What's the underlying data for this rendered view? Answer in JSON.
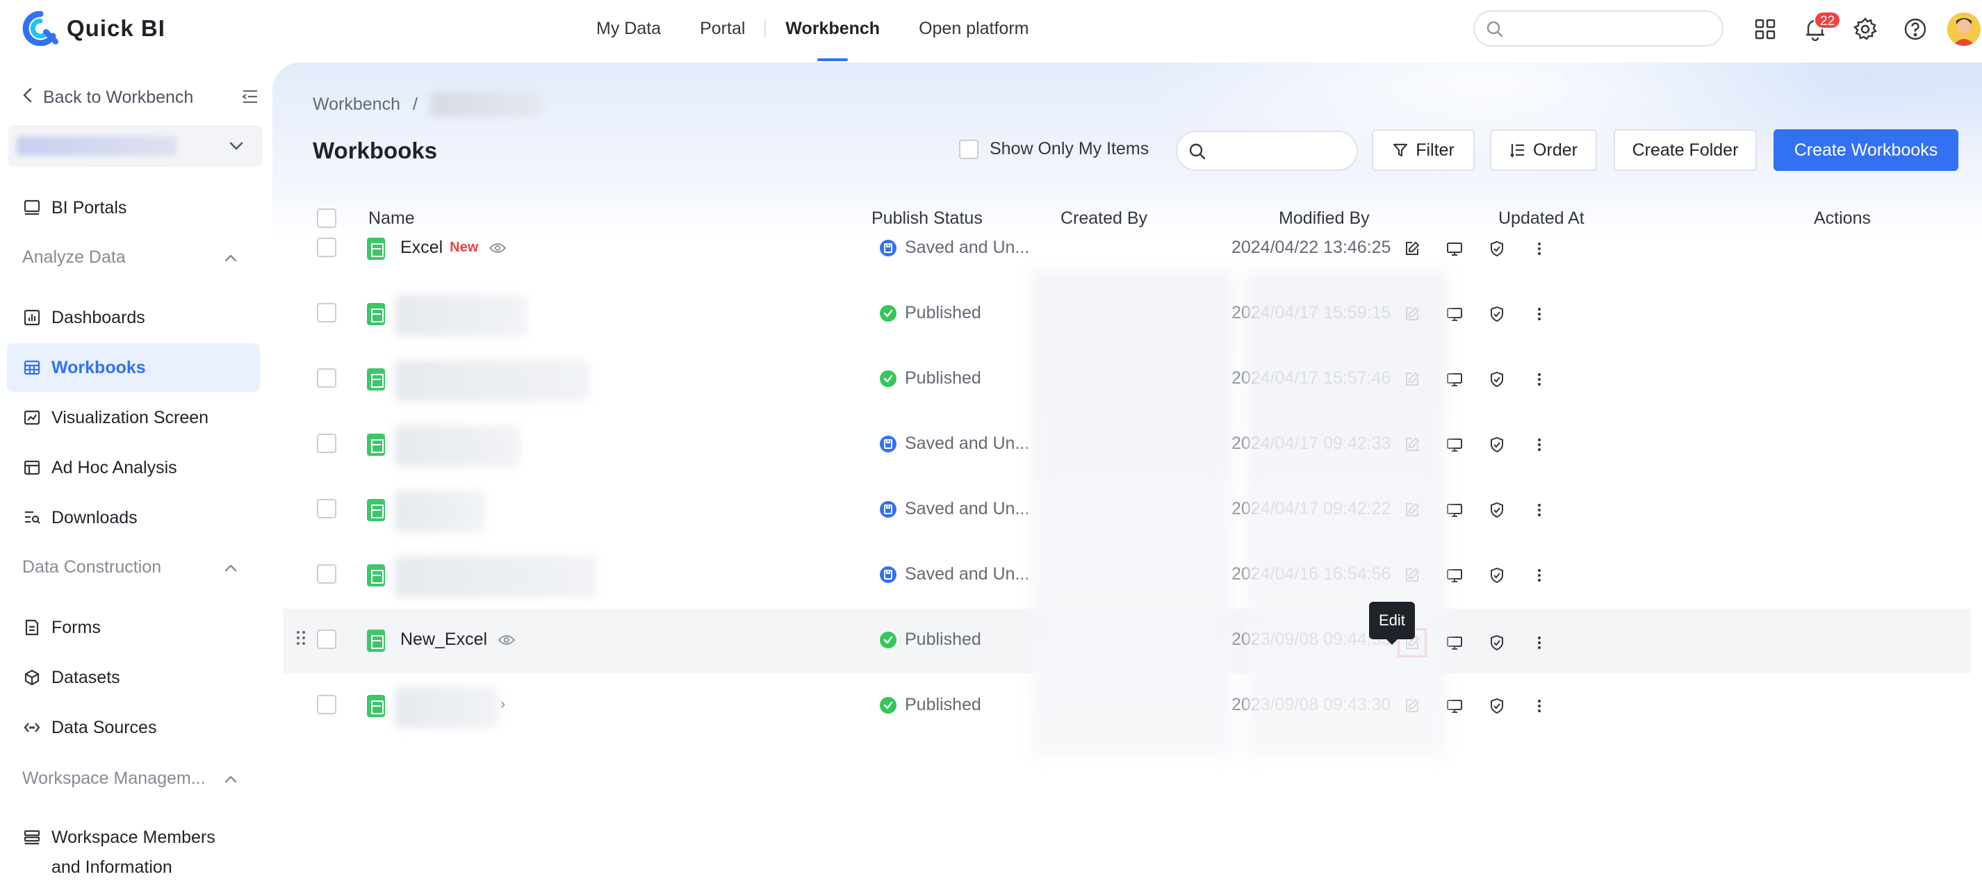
{
  "app": {
    "name": "Quick BI",
    "brand_color": "#3271f3"
  },
  "topnav": {
    "items": [
      {
        "label": "My Data"
      },
      {
        "label": "Portal"
      },
      {
        "label": "Workbench",
        "active": true
      },
      {
        "label": "Open platform"
      }
    ],
    "search_placeholder": "",
    "notification_count": "22",
    "icons": [
      "apps-grid-icon",
      "bell-icon",
      "gear-icon",
      "help-icon",
      "avatar"
    ]
  },
  "sidebar": {
    "back_label": "Back to Workbench",
    "workspace_name": "",
    "items": [
      {
        "label": "BI Portals",
        "icon": "monitor-icon"
      },
      {
        "group": "Analyze Data"
      },
      {
        "label": "Dashboards",
        "icon": "dashboard-icon"
      },
      {
        "label": "Workbooks",
        "icon": "table-icon",
        "active": true
      },
      {
        "label": "Visualization Screen",
        "icon": "chart-screen-icon"
      },
      {
        "label": "Ad Hoc Analysis",
        "icon": "adhoc-icon"
      },
      {
        "label": "Downloads",
        "icon": "downloads-icon"
      },
      {
        "group": "Data Construction"
      },
      {
        "label": "Forms",
        "icon": "form-icon"
      },
      {
        "label": "Datasets",
        "icon": "cube-icon"
      },
      {
        "label": "Data Sources",
        "icon": "link-icon"
      },
      {
        "group": "Workspace Managem..."
      },
      {
        "label": "Workspace Members and Information",
        "icon": "members-icon"
      }
    ]
  },
  "breadcrumb": {
    "root": "Workbench",
    "separator": "/"
  },
  "page": {
    "title": "Workbooks"
  },
  "toolbar": {
    "show_only_mine": "Show Only My Items",
    "search_placeholder": "",
    "filter": "Filter",
    "order": "Order",
    "create_folder": "Create Folder",
    "create_workbooks": "Create Workbooks"
  },
  "table": {
    "columns": [
      "Name",
      "Publish Status",
      "Created By",
      "Modified By",
      "Updated At",
      "Actions"
    ],
    "rows": [
      {
        "name": "Excel",
        "new_badge": "New",
        "status": "Saved and Un...",
        "status_type": "saved",
        "updated": "2024/04/22 13:46:25"
      },
      {
        "name": "",
        "status": "Published",
        "status_type": "published",
        "updated": "2024/04/17 15:59:15"
      },
      {
        "name": "",
        "status": "Published",
        "status_type": "published",
        "updated": "2024/04/17 15:57:46"
      },
      {
        "name": "",
        "status": "Saved and Un...",
        "status_type": "saved",
        "updated": "2024/04/17 09:42:33"
      },
      {
        "name": "",
        "status": "Saved and Un...",
        "status_type": "saved",
        "updated": "2024/04/17 09:42:22"
      },
      {
        "name": "",
        "status": "Saved and Un...",
        "status_type": "saved",
        "updated": "2024/04/16 16:54:56"
      },
      {
        "name": "New_Excel",
        "status": "Published",
        "status_type": "published",
        "updated": "2023/09/08 09:44:35"
      },
      {
        "name": "",
        "status": "Published",
        "status_type": "published",
        "updated": "2023/09/08 09:43:30"
      }
    ]
  },
  "tooltip": {
    "edit": "Edit"
  }
}
